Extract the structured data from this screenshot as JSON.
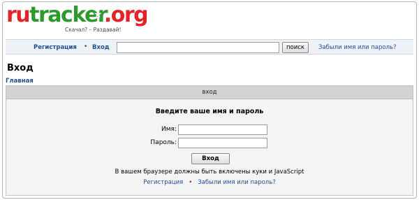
{
  "logo": {
    "part_ru": "ru",
    "part_tracker": "tracker",
    "part_org": ".org",
    "tagline": "Скачал? – Раздавай!"
  },
  "nav": {
    "register": "Регистрация",
    "separator": "•",
    "login": "Вход",
    "search_value": "",
    "search_button": "поиск",
    "forgot": "Забыли имя или пароль?"
  },
  "page": {
    "title": "Вход",
    "breadcrumb": "Главная"
  },
  "panel": {
    "header": "вход",
    "heading": "Введите ваше имя и пароль",
    "username_label": "Имя:",
    "username_value": "",
    "password_label": "Пароль:",
    "password_value": "",
    "submit": "Вход",
    "cookie_note": "В вашем браузере должны быть включены куки и JavaScript",
    "register_link": "Регистрация",
    "separator": "•",
    "forgot_link": "Забыли имя или пароль?"
  },
  "colors": {
    "link": "#1f4f8f",
    "logo_red": "#e2232a",
    "logo_green": "#2e9a2e",
    "panel_header": "#d3d3d3"
  }
}
